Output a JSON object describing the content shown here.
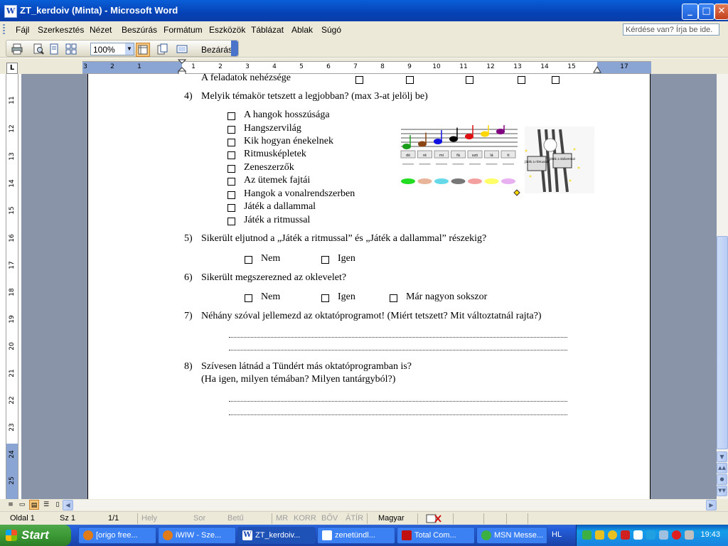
{
  "window": {
    "title": "ZT_kerdoiv (Minta) - Microsoft Word",
    "app_icon": "W",
    "minimize_glyph": "_",
    "maximize_glyph": "□",
    "close_glyph": "✕"
  },
  "menu": {
    "items": [
      "Fájl",
      "Szerkesztés",
      "Nézet",
      "Beszúrás",
      "Formátum",
      "Eszközök",
      "Táblázat",
      "Ablak",
      "Súgó"
    ],
    "help_box": "Kérdése van? Írja be ide."
  },
  "toolbar": {
    "zoom": "100%",
    "close_label": "Bezárás"
  },
  "ruler": {
    "corner": "L",
    "h_numbers": [
      "3",
      "2",
      "1",
      "1",
      "2",
      "3",
      "4",
      "5",
      "6",
      "7",
      "8",
      "9",
      "10",
      "11",
      "12",
      "13",
      "14",
      "15",
      "17"
    ],
    "v_numbers": [
      "11",
      "12",
      "13",
      "14",
      "15",
      "16",
      "17",
      "18",
      "19",
      "20",
      "21",
      "22",
      "23",
      "24",
      "25"
    ]
  },
  "document": {
    "top_row_label": "A feladatok nehézsége",
    "q4": {
      "number": "4)",
      "text": "Melyik témakör tetszett a legjobban? (max 3-at jelölj be)",
      "options": [
        "A hangok hosszúsága",
        "Hangszervilág",
        "Kik hogyan énekelnek",
        "Ritmusképletek",
        "Zeneszerzők",
        "Az ütemek fajtái",
        "Hangok a vonalrendszerben",
        "Játék a dallammal",
        "Játék a ritmussal"
      ]
    },
    "q5": {
      "number": "5)",
      "text": "Sikerült eljutnod a „Játék a ritmussal” és „Játék a dallammal” részekig?",
      "options": [
        "Nem",
        "Igen"
      ]
    },
    "q6": {
      "number": "6)",
      "text": "Sikerült megszerezned az oklevelet?",
      "options": [
        "Nem",
        "Igen",
        "Már nagyon sokszor"
      ]
    },
    "q7": {
      "number": "7)",
      "text": "Néhány szóval jellemezd az oktatóprogramot! (Miért tetszett? Mit változtatnál rajta?)"
    },
    "q8": {
      "number": "8)",
      "line1": "Szívesen látnád a Tündért más oktatóprogramban is?",
      "line2": "(Ha igen, milyen témában? Milyen tantárgyból?)"
    },
    "image_solfege": [
      "dó",
      "ré",
      "mi",
      "fá",
      "szó",
      "lá",
      "ti"
    ],
    "note_colors": [
      "#1a9e1a",
      "#8b4513",
      "#1010e0",
      "#000000",
      "#e01010",
      "#ffd700",
      "#800080"
    ],
    "oval_colors": [
      "#22dd22",
      "#e8b49a",
      "#66d9e8",
      "#777777",
      "#f5a0a0",
      "#ffff66",
      "#e8b0f0"
    ],
    "signs": [
      "Játék a ritmussal",
      "Játék a dallammal"
    ]
  },
  "statusbar": {
    "page": "Oldal 1",
    "section": "Sz 1",
    "pages": "1/1",
    "at": "Hely",
    "line": "Sor",
    "col": "Betű",
    "rec": "MR",
    "trk": "KORR",
    "ext": "BŐV",
    "ovr": "ÁTÍR",
    "language": "Magyar"
  },
  "taskbar": {
    "start": "Start",
    "tasks": [
      "[origo free...",
      "iWIW - Sze...",
      "ZT_kerdoiv...",
      "zenetündl...",
      "Total Com...",
      "MSN Messe..."
    ],
    "language": "HL",
    "clock": "19:43"
  },
  "colors": {
    "titlebar": "#0542b6",
    "chrome": "#ece9d8",
    "doc_background": "#8a94a8",
    "ruler_margin": "#8aa4d3",
    "start_green": "#3c9a35",
    "taskbar_blue": "#245edb"
  }
}
